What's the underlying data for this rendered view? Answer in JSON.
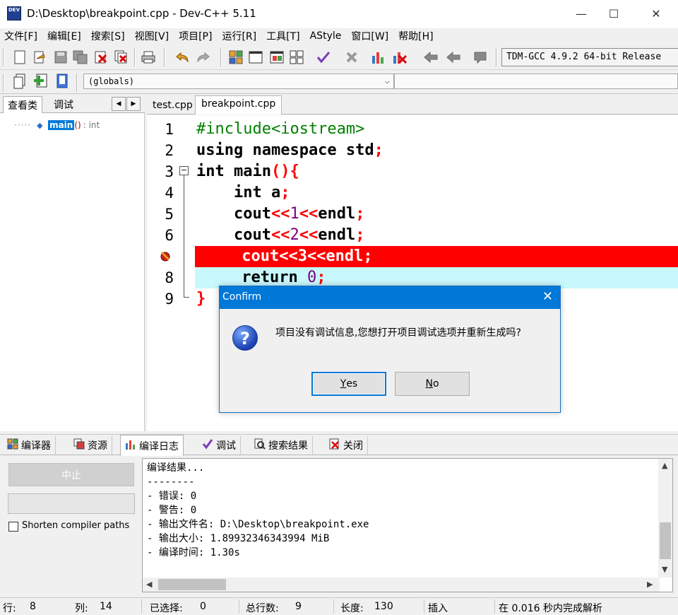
{
  "window": {
    "app_icon_text": "DEV",
    "title": "D:\\Desktop\\breakpoint.cpp - Dev-C++ 5.11",
    "min_glyph": "—",
    "max_glyph": "☐",
    "close_glyph": "✕"
  },
  "menu": [
    {
      "label": "文件[F]"
    },
    {
      "label": "编辑[E]"
    },
    {
      "label": "搜索[S]"
    },
    {
      "label": "视图[V]"
    },
    {
      "label": "项目[P]"
    },
    {
      "label": "运行[R]"
    },
    {
      "label": "工具[T]"
    },
    {
      "label": "AStyle"
    },
    {
      "label": "窗口[W]"
    },
    {
      "label": "帮助[H]"
    }
  ],
  "toolbar": {
    "compiler": "TDM-GCC 4.9.2 64-bit Release",
    "scope": "(globals)"
  },
  "left_panel": {
    "tabs": [
      "查看类",
      "调试"
    ],
    "tree": {
      "name": "main",
      "params": "()",
      "type": ": int"
    }
  },
  "editor": {
    "tabs": [
      "test.cpp",
      "breakpoint.cpp"
    ],
    "line_numbers": [
      "1",
      "2",
      "3",
      "4",
      "5",
      "6",
      "",
      "8",
      "9"
    ]
  },
  "dialog": {
    "title": "Confirm",
    "message": "项目没有调试信息,您想打开项目调试选项并重新生成吗?",
    "yes_first": "Y",
    "yes_rest": "es",
    "no_first": "N",
    "no_rest": "o"
  },
  "bottom_tabs": [
    {
      "label": "编译器"
    },
    {
      "label": "资源"
    },
    {
      "label": "编译日志"
    },
    {
      "label": "调试"
    },
    {
      "label": "搜索结果"
    },
    {
      "label": "关闭"
    }
  ],
  "compile_panel": {
    "abort_label": "中止",
    "shorten_label": "Shorten compiler paths",
    "log": [
      "编译结果...",
      "--------",
      "- 错误: 0",
      "- 警告: 0",
      "- 输出文件名: D:\\Desktop\\breakpoint.exe",
      "- 输出大小: 1.89932346343994 MiB",
      "- 编译时间: 1.30s"
    ]
  },
  "status": {
    "row_label": "行:",
    "row_value": "8",
    "col_label": "列:",
    "col_value": "14",
    "sel_label": "已选择:",
    "sel_value": "0",
    "lines_label": "总行数:",
    "lines_value": "9",
    "length_label": "长度:",
    "length_value": "130",
    "mode": "插入",
    "parse_info": "在 0.016 秒内完成解析"
  }
}
